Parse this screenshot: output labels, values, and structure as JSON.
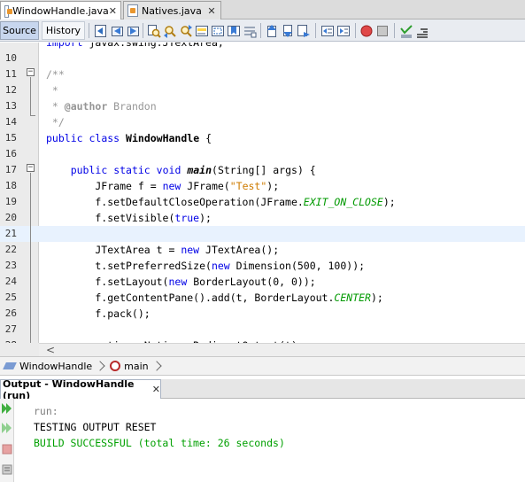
{
  "tabs": [
    {
      "label": "WindowHandle.java",
      "active": true
    },
    {
      "label": "Natives.java",
      "active": false
    }
  ],
  "close_glyph": "✕",
  "toolbar": {
    "source_label": "Source",
    "history_label": "History"
  },
  "editor": {
    "partial_top_line": "import javax.swing.JTextArea;",
    "lines": [
      {
        "num": "10",
        "code": ""
      },
      {
        "num": "11",
        "code": "/**"
      },
      {
        "num": "12",
        "code": " *"
      },
      {
        "num": "13",
        "code": " * @author Brandon"
      },
      {
        "num": "14",
        "code": " */"
      },
      {
        "num": "15",
        "code": "public class WindowHandle {"
      },
      {
        "num": "16",
        "code": ""
      },
      {
        "num": "17",
        "code": "    public static void main(String[] args) {"
      },
      {
        "num": "18",
        "code": "        JFrame f = new JFrame(\"Test\");"
      },
      {
        "num": "19",
        "code": "        f.setDefaultCloseOperation(JFrame.EXIT_ON_CLOSE);"
      },
      {
        "num": "20",
        "code": "        f.setVisible(true);"
      },
      {
        "num": "21",
        "code": ""
      },
      {
        "num": "22",
        "code": "        JTextArea t = new JTextArea();"
      },
      {
        "num": "23",
        "code": "        t.setPreferredSize(new Dimension(500, 100));"
      },
      {
        "num": "24",
        "code": "        f.setLayout(new BorderLayout(0, 0));"
      },
      {
        "num": "25",
        "code": "        f.getContentPane().add(t, BorderLayout.CENTER);"
      },
      {
        "num": "26",
        "code": "        f.pack();"
      },
      {
        "num": "27",
        "code": ""
      },
      {
        "num": "28",
        "code": "        natives.Natives.RedirectOutput(t);"
      }
    ],
    "current_line": "21",
    "colors": {
      "keyword": "#0000e6",
      "comment": "#969696",
      "string": "#ce7b00",
      "constant": "#009900"
    }
  },
  "breadcrumb": {
    "items": [
      {
        "label": "WindowHandle",
        "icon": "class-icon"
      },
      {
        "label": "main",
        "icon": "method-icon"
      }
    ]
  },
  "output": {
    "tab_label": "Output - WindowHandle (run)",
    "lines": [
      {
        "text": "run:",
        "style": "gray"
      },
      {
        "text": "TESTING OUTPUT RESET",
        "style": "black"
      },
      {
        "text": "BUILD SUCCESSFUL (total time: 26 seconds)",
        "style": "green"
      }
    ]
  }
}
